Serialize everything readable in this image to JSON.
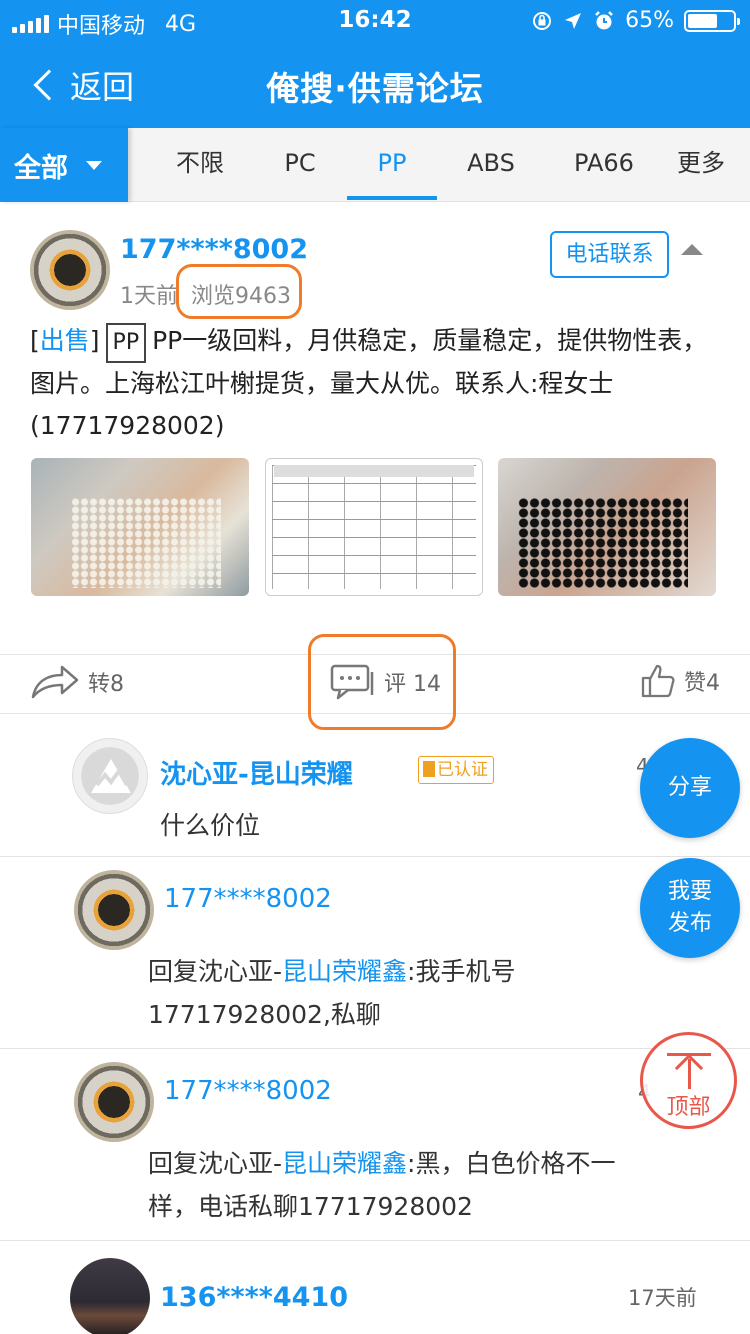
{
  "status_bar": {
    "carrier": "中国移动",
    "network": "4G",
    "time": "16:42",
    "battery": "65%",
    "battery_level": 0.65
  },
  "header": {
    "back_label": "返回",
    "title": "俺搜·供需论坛"
  },
  "category_bar": {
    "all_label": "全部",
    "tabs": [
      "不限",
      "PC",
      "PP",
      "ABS",
      "PA66",
      "更多"
    ],
    "active": "PP"
  },
  "post": {
    "user": "177****8002",
    "time_ago": "1天前",
    "views": "浏览9463",
    "contact_button": "电话联系",
    "tag_sale": "出售",
    "tag_material": "PP",
    "text": "PP一级回料，月供稳定，质量稳定，提供物性表，图片。上海松江叶榭提货，量大从优。联系人:程女士(17717928002)",
    "bracket_open": "[",
    "bracket_close": "]"
  },
  "actions": {
    "forward": "转8",
    "comment": "评 14",
    "like": "赞4"
  },
  "comments": [
    {
      "user": "沈心亚-昆山荣耀",
      "badge": "已认证",
      "text": "什么价位",
      "clipped_date": "4"
    },
    {
      "user": "177****8002",
      "reply_prefix": "回复沈心亚-",
      "reply_target": "昆山荣耀鑫",
      "text_line1": ":我手机号",
      "text_line2": "17717928002,私聊"
    },
    {
      "user": "177****8002",
      "reply_prefix": "回复沈心亚-",
      "reply_target": "昆山荣耀鑫",
      "text_line1": ":黑，白色价格不一",
      "text_line2": "样，电话私聊17717928002",
      "clipped_date": "4"
    },
    {
      "user": "136****4410",
      "date": "17天前"
    }
  ],
  "floating": {
    "share": "分享",
    "publish_line1": "我要",
    "publish_line2": "发布",
    "top": "顶部"
  },
  "colors": {
    "primary": "#1493F0",
    "highlight": "#F07C2A",
    "verified": "#F0A020",
    "to_top": "#E8574A"
  }
}
